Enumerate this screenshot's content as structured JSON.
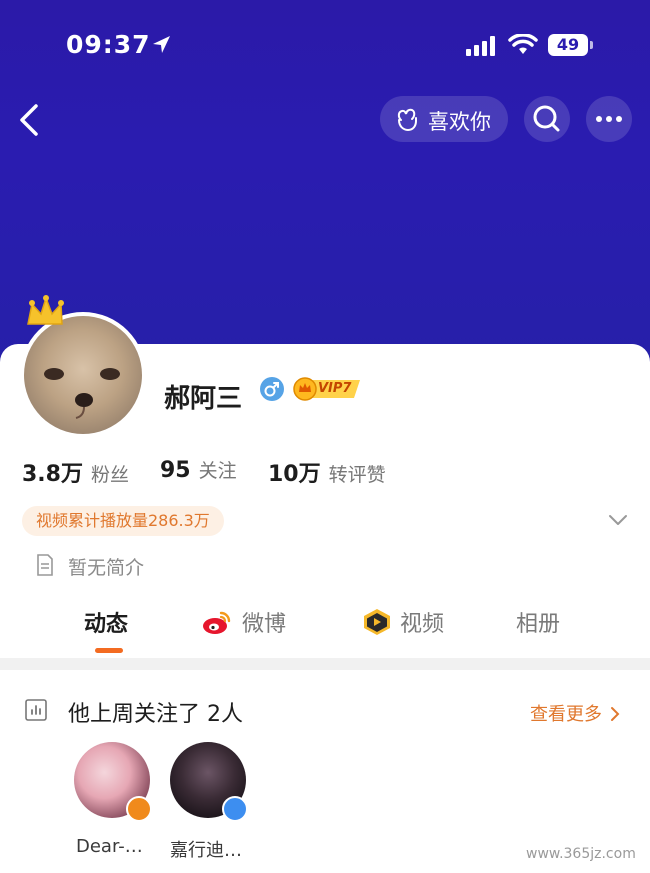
{
  "status_bar": {
    "time": "09:37",
    "battery": "49"
  },
  "nav": {
    "like_label": "喜欢你"
  },
  "profile": {
    "name": "郝阿三",
    "vip_label": "VIP7",
    "stats": [
      {
        "value": "3.8万",
        "label": "粉丝"
      },
      {
        "value": "95",
        "label": "关注"
      },
      {
        "value": "10万",
        "label": "转评赞"
      }
    ],
    "play_count_badge": "视频累计播放量286.3万",
    "bio": "暂无简介"
  },
  "tabs": [
    {
      "label": "动态",
      "active": true
    },
    {
      "label": "微博",
      "icon": "weibo-icon"
    },
    {
      "label": "视频",
      "icon": "video-icon"
    },
    {
      "label": "相册"
    }
  ],
  "following_section": {
    "title": "他上周关注了 2人",
    "see_more": "查看更多",
    "users": [
      {
        "name": "Dear-…",
        "badge_color": "#f08a1c"
      },
      {
        "name": "嘉行迪…",
        "badge_color": "#3d8ef0"
      }
    ]
  },
  "watermark": "www.365jz.com",
  "colors": {
    "header_bg": "#2a1cb0",
    "accent": "#f36b21",
    "link": "#e0782e"
  }
}
